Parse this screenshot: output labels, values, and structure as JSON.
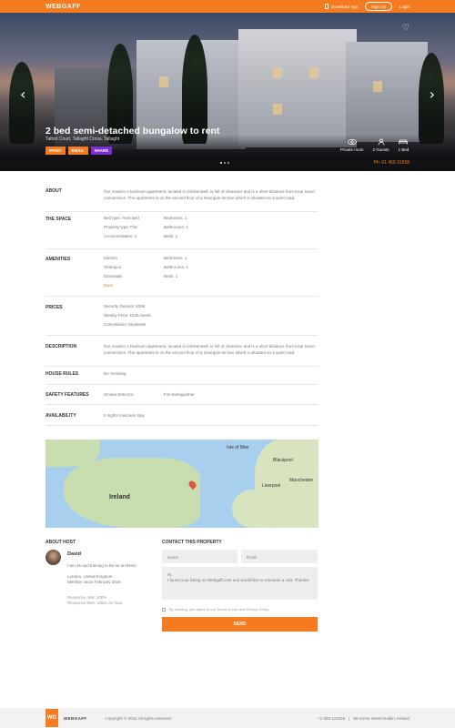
{
  "header": {
    "logo": "WEBGAFF",
    "download_app": "Download App",
    "sign_up": "Sign Up",
    "login": "Login"
  },
  "hero": {
    "title": "2 bed semi-detached bungalow to rent",
    "subtitle": "Talbot Court, Tallaght Cross, Tallaght",
    "buttons": {
      "print": "PRINT",
      "email": "EMAIL",
      "share": "SHARE"
    },
    "features": [
      {
        "icon": "eye-icon",
        "label": "Private room"
      },
      {
        "icon": "person-icon",
        "label": "2 Guests"
      },
      {
        "icon": "bed-icon",
        "label": "1 Bed"
      }
    ],
    "phone": "Ph: 01 450 31558"
  },
  "sections": {
    "about": {
      "label": "ABOUT",
      "text": "Our modern 4 bedroom apartment, located in Clerkenwell, is full of character and is a short distance from local travel connections. The apartment is on the second floor of a Georgian terrace which is situated on a quiet road."
    },
    "space": {
      "label": "THE SPACE",
      "col1": [
        "Bed type: Real Bed",
        "Property type: Flat",
        "Accommodates: 2"
      ],
      "col2": [
        "Bedrooms: 1",
        "Bathrooms: 1",
        "Beds: 1"
      ]
    },
    "amenities": {
      "label": "AMENITIES",
      "col1": [
        "Kitchen",
        "Shampoo",
        "Essentials"
      ],
      "col2": [
        "Bedrooms: 1",
        "Bathrooms: 1",
        "Beds: 1"
      ],
      "more": "More"
    },
    "prices": {
      "label": "PRICES",
      "lines": [
        "Security Deposit: €286",
        "Weekly Price: €426 /week",
        "Cancellation: Moderate"
      ]
    },
    "description": {
      "label": "DESCRIPTION",
      "text": "Our modern 4 bedroom apartment, located in Clerkenwell, is full of character and is a short distance from local travel connections. The apartment is on the second floor of a Georgian terrace which is situated on a quiet road."
    },
    "house_rules": {
      "label": "HOUSE RULES",
      "text": "No Smoking"
    },
    "safety": {
      "label": "SAFETY FEATURES",
      "col1": "Smoke Detector",
      "col2": "Fire Extinguisher"
    },
    "availability": {
      "label": "AVAILABILITY",
      "text": "2 nights minimum stay"
    }
  },
  "map": {
    "labels": {
      "ireland": "Ireland",
      "isle_of_man": "Isle of Man",
      "liverpool": "Liverpool",
      "manchester": "Manchester",
      "blackpool": "Blackpool"
    }
  },
  "host": {
    "title": "ABOUT HOST",
    "name": "David",
    "bio": "I am 25 and training to be an architect.",
    "location": "London, United Kingdom",
    "member_since": "Member since February 2016",
    "response_rate": "Response rate: 100%",
    "response_time": "Response time: within an hour"
  },
  "contact": {
    "title": "CONTACT THIS PROPERTY",
    "name_placeholder": "Name",
    "email_placeholder": "Email",
    "message": "Hi,\nI found your listing on Webgaff.com and would like to schedule a visit. Thanks!",
    "agree": "By sending, you agree to our Terms of Use and Privacy Policy",
    "send": "SEND"
  },
  "footer": {
    "logo_mark": "WG",
    "brand": "WEBGAFF",
    "copyright": "Copyright © 2016 All rights reserved.",
    "phone": "+1 550 123456",
    "separator": "|",
    "address": "69 Some Street Dublin, Ireland"
  },
  "colors": {
    "accent": "#f47b20",
    "share": "#7b2fd0"
  }
}
